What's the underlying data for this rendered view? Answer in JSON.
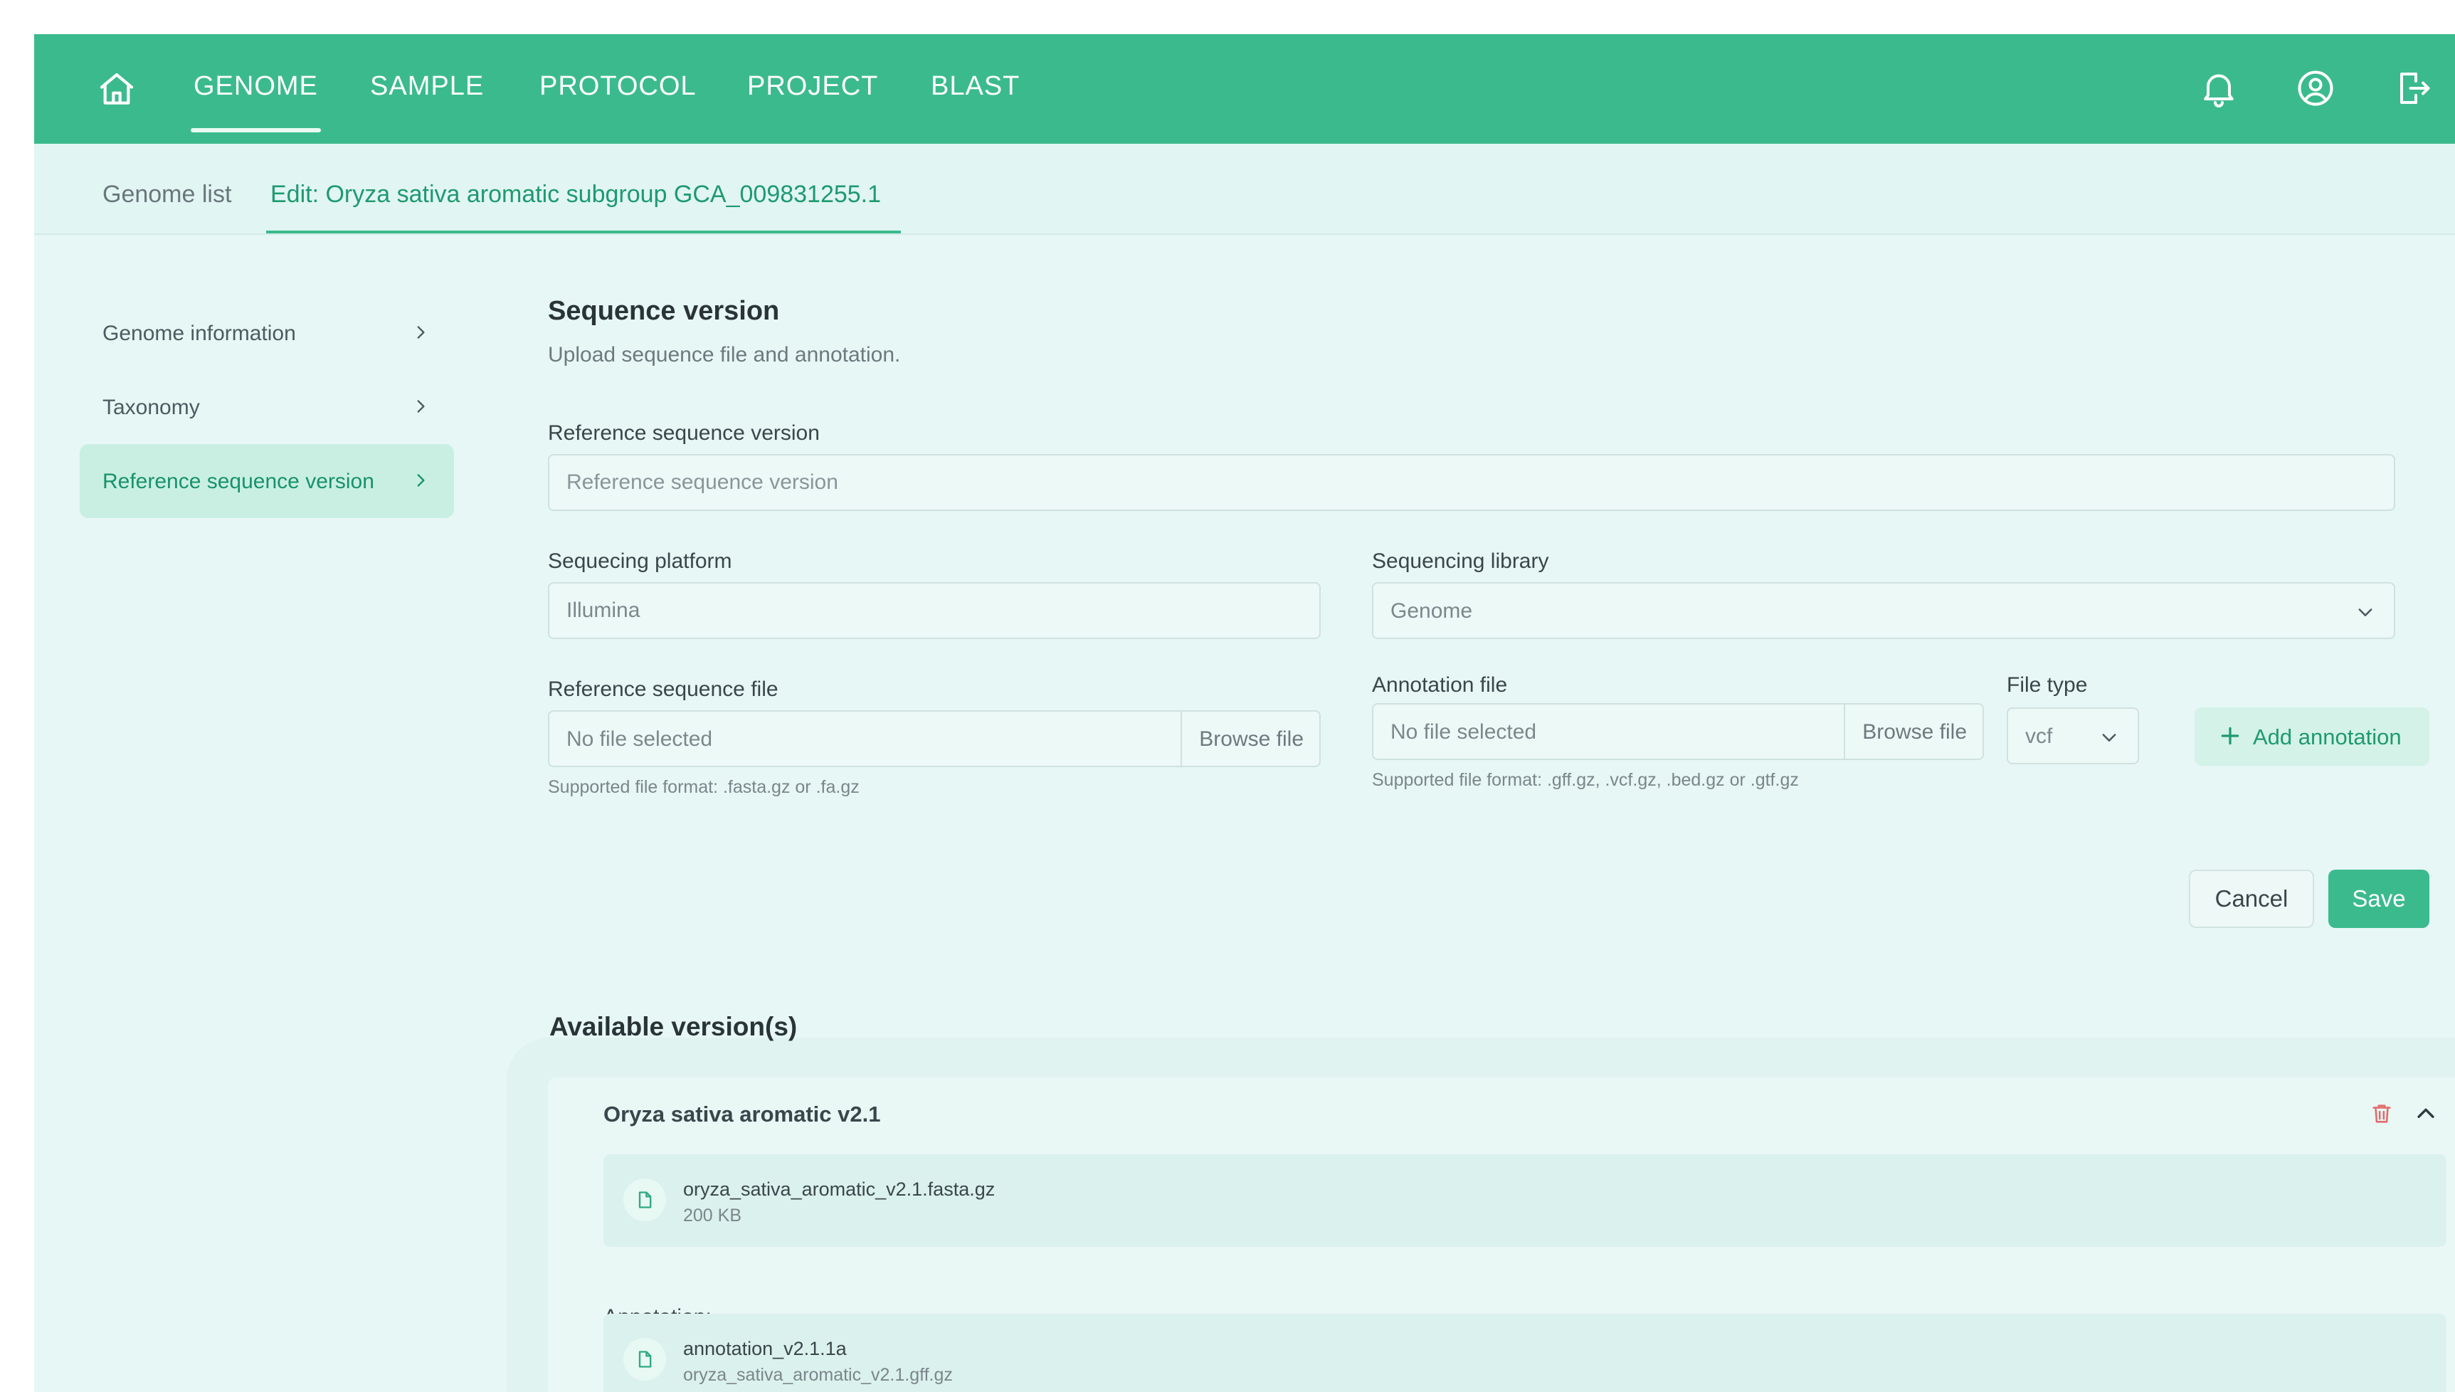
{
  "nav": {
    "items": [
      {
        "label": "GENOME",
        "active": true
      },
      {
        "label": "SAMPLE"
      },
      {
        "label": "PROTOCOL"
      },
      {
        "label": "PROJECT"
      },
      {
        "label": "BLAST"
      }
    ],
    "icons": [
      "home-icon",
      "bell-icon",
      "user-circle-icon",
      "logout-icon"
    ]
  },
  "breadcrumb": {
    "list_label": "Genome list",
    "edit_label": "Edit:  Oryza sativa aromatic subgroup GCA_009831255.1"
  },
  "sidebar": {
    "items": [
      {
        "label": "Genome information"
      },
      {
        "label": "Taxonomy"
      },
      {
        "label": "Reference sequence version",
        "active": true
      }
    ]
  },
  "form": {
    "title": "Sequence version",
    "subtitle": "Upload sequence file and annotation.",
    "ref_version": {
      "label": "Reference sequence version",
      "placeholder": "Reference sequence version"
    },
    "platform": {
      "label": "Sequecing platform",
      "value": "Illumina"
    },
    "library": {
      "label": "Sequencing library",
      "value": "Genome"
    },
    "ref_file": {
      "label": "Reference sequence file",
      "value": "No file selected",
      "browse": "Browse file",
      "hint": "Supported file format: .fasta.gz or .fa.gz"
    },
    "annotation_file": {
      "label": "Annotation file",
      "value": "No file selected",
      "browse": "Browse file",
      "hint": "Supported file format: .gff.gz, .vcf.gz, .bed.gz or .gtf.gz"
    },
    "file_type": {
      "label": "File type",
      "value": "vcf"
    },
    "add_annotation": "Add annotation",
    "cancel": "Cancel",
    "save": "Save"
  },
  "available": {
    "title": "Available version(s)",
    "versions": [
      {
        "name": "Oryza sativa aromatic v2.1",
        "sequence_file": {
          "name": "oryza_sativa_aromatic_v2.1.fasta.gz",
          "size": "200 KB"
        },
        "annotation_label": "Annotation:",
        "annotations": [
          {
            "name": "annotation_v2.1.1a",
            "file": "oryza_sativa_aromatic_v2.1.gff.gz"
          }
        ]
      }
    ]
  },
  "colors": {
    "brand": "#3bba8e",
    "background": "#e6f7f5",
    "active_text": "#1e9a6f",
    "danger": "#e26b6b"
  }
}
